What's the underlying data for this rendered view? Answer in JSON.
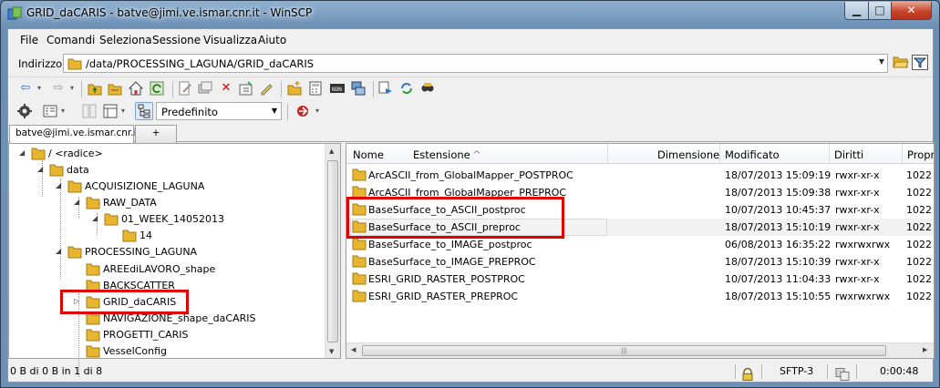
{
  "window": {
    "title": "GRID_daCARIS - batve@jimi.ve.ismar.cnr.it - WinSCP",
    "minimize": "▁",
    "maximize": "□",
    "close": "✕"
  },
  "menu": [
    "File",
    "Comandi",
    "Seleziona",
    "Sessione",
    "Visualizza",
    "Aiuto"
  ],
  "address": {
    "label": "Indirizzo",
    "path": "/data/PROCESSING_LAGUNA/GRID_daCARIS"
  },
  "toolbar": {
    "preset": "Predefinito"
  },
  "tabs": {
    "session": "batve@jimi.ve.ismar.cnr.it",
    "new": "+"
  },
  "tree": [
    {
      "label": "/ <radice>",
      "expanded": true
    },
    {
      "label": "data",
      "expanded": true
    },
    {
      "label": "ACQUISIZIONE_LAGUNA",
      "expanded": true
    },
    {
      "label": "RAW_DATA",
      "expanded": true
    },
    {
      "label": "01_WEEK_14052013",
      "expanded": true
    },
    {
      "label": "14"
    },
    {
      "label": "PROCESSING_LAGUNA",
      "expanded": true
    },
    {
      "label": "AREEdiLAVORO_shape"
    },
    {
      "label": "BACKSCATTER"
    },
    {
      "label": "GRID_daCARIS",
      "collapsed": true
    },
    {
      "label": "NAVIGAZIONE_shape_daCARIS"
    },
    {
      "label": "PROGETTI_CARIS"
    },
    {
      "label": "VesselConfig"
    }
  ],
  "columns": {
    "name": "Nome",
    "ext": "Estensione",
    "size": "Dimensione",
    "modified": "Modificato",
    "rights": "Diritti",
    "owner": "Propr"
  },
  "files": [
    {
      "name": "ArcASCII_from_GlobalMapper_POSTPROC",
      "modified": "18/07/2013 15:09:19",
      "rights": "rwxr-xr-x",
      "owner": "1022"
    },
    {
      "name": "ArcASCII_from_GlobalMapper_PREPROC",
      "modified": "18/07/2013 15:09:38",
      "rights": "rwxr-xr-x",
      "owner": "1022"
    },
    {
      "name": "BaseSurface_to_ASCII_postproc",
      "modified": "10/07/2013 10:45:37",
      "rights": "rwxr-xr-x",
      "owner": "1022"
    },
    {
      "name": "BaseSurface_to_ASCII_preproc",
      "modified": "18/07/2013 15:10:19",
      "rights": "rwxr-xr-x",
      "owner": "1022"
    },
    {
      "name": "BaseSurface_to_IMAGE_postproc",
      "modified": "06/08/2013 16:35:22",
      "rights": "rwxrwxrwx",
      "owner": "1022"
    },
    {
      "name": "BaseSurface_to_IMAGE_PREPROC",
      "modified": "18/07/2013 15:10:39",
      "rights": "rwxr-xr-x",
      "owner": "1022"
    },
    {
      "name": "ESRI_GRID_RASTER_POSTPROC",
      "modified": "10/07/2013 11:04:33",
      "rights": "rwxr-xr-x",
      "owner": "1022"
    },
    {
      "name": "ESRI_GRID_RASTER_PREPROC",
      "modified": "18/07/2013 15:10:55",
      "rights": "rwxrwxrwx",
      "owner": "1022"
    }
  ],
  "status": {
    "selection": "0 B di 0 B in 1 di 8",
    "protocol": "SFTP-3",
    "time": "0:00:48"
  },
  "colors": {
    "highlight": "#e00000",
    "folder": "#e8b530"
  }
}
